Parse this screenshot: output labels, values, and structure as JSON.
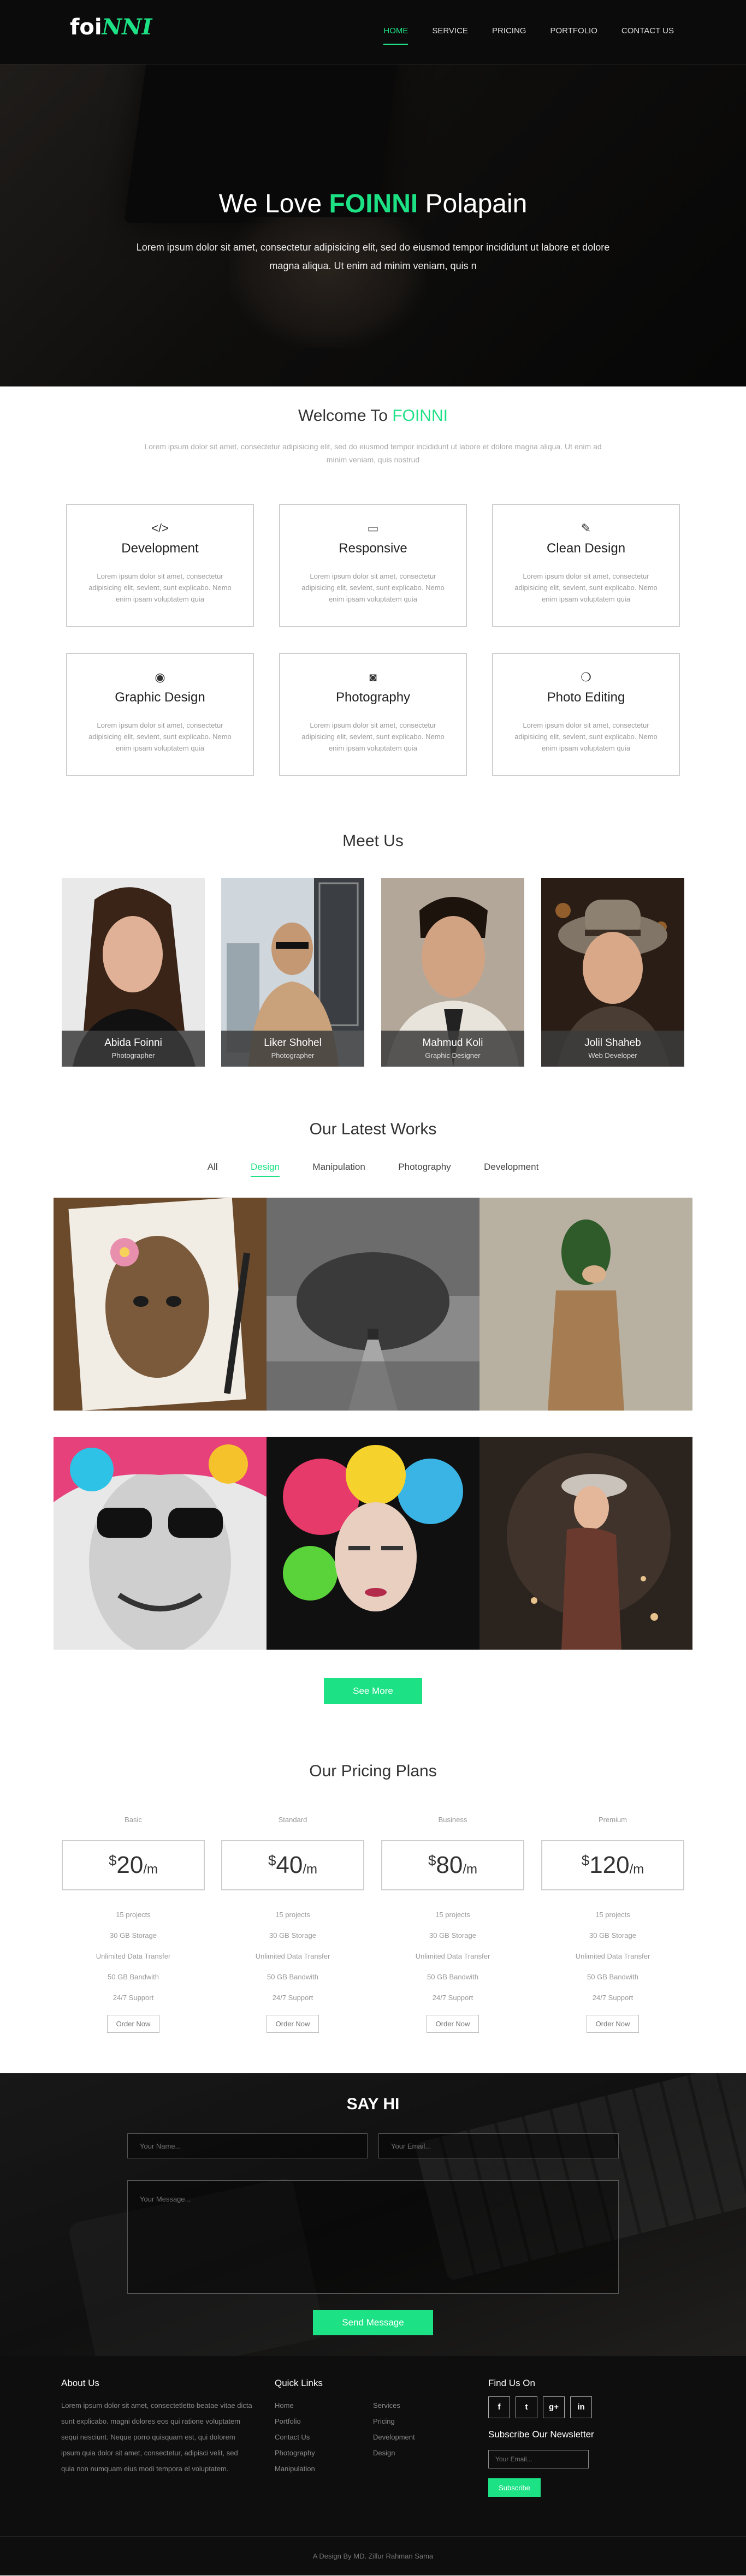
{
  "nav": {
    "logo_main": "foi",
    "logo_accent": "NNI",
    "items": [
      "HOME",
      "SERVICE",
      "PRICING",
      "PORTFOLIO",
      "CONTACT US"
    ],
    "active": "HOME"
  },
  "hero": {
    "title_pre": "We Love ",
    "title_accent": "FOINNI",
    "title_post": " Polapain",
    "text": "Lorem ipsum dolor sit amet, consectetur adipisicing elit, sed do eiusmod tempor incididunt ut labore et dolore magna aliqua. Ut enim ad minim veniam, quis n"
  },
  "welcome": {
    "title_pre": "Welcome To ",
    "title_accent": "FOINNI",
    "text": "Lorem ipsum dolor sit amet, consectetur adipisicing elit, sed do eiusmod tempor incididunt ut labore et dolore magna aliqua. Ut enim ad minim veniam, quis nostrud"
  },
  "services": [
    {
      "icon": "code-icon",
      "glyph": "</>",
      "title": "Development",
      "text": "Lorem ipsum dolor sit amet, consectetur adipisicing elit, sevlent, sunt explicabo. Nemo enim ipsam voluptatem quia"
    },
    {
      "icon": "monitor-icon",
      "glyph": "▭",
      "title": "Responsive",
      "text": "Lorem ipsum dolor sit amet, consectetur adipisicing elit, sevlent, sunt explicabo. Nemo enim ipsam voluptatem quia"
    },
    {
      "icon": "brush-icon",
      "glyph": "✎",
      "title": "Clean Design",
      "text": "Lorem ipsum dolor sit amet, consectetur adipisicing elit, sevlent, sunt explicabo. Nemo enim ipsam voluptatem quia"
    },
    {
      "icon": "eye-icon",
      "glyph": "◉",
      "title": "Graphic Design",
      "text": "Lorem ipsum dolor sit amet, consectetur adipisicing elit, sevlent, sunt explicabo. Nemo enim ipsam voluptatem quia"
    },
    {
      "icon": "camera-icon",
      "glyph": "◙",
      "title": "Photography",
      "text": "Lorem ipsum dolor sit amet, consectetur adipisicing elit, sevlent, sunt explicabo. Nemo enim ipsam voluptatem quia"
    },
    {
      "icon": "aperture-icon",
      "glyph": "❍",
      "title": "Photo Editing",
      "text": "Lorem ipsum dolor sit amet, consectetur adipisicing elit, sevlent, sunt explicabo. Nemo enim ipsam voluptatem quia"
    }
  ],
  "team": {
    "title": "Meet Us",
    "members": [
      {
        "name": "Abida Foinni",
        "role": "Photographer"
      },
      {
        "name": "Liker Shohel",
        "role": "Photographer"
      },
      {
        "name": "Mahmud Koli",
        "role": "Graphic Designer"
      },
      {
        "name": "Jolil Shaheb",
        "role": "Web Developer"
      }
    ]
  },
  "works": {
    "title": "Our Latest Works",
    "filters": [
      "All",
      "Design",
      "Manipulation",
      "Photography",
      "Development"
    ],
    "active_filter": "Design",
    "see_more": "See More"
  },
  "pricing": {
    "title": "Our Pricing Plans",
    "plans": [
      {
        "name": "Basic",
        "currency": "$",
        "price": "20",
        "per": "/m"
      },
      {
        "name": "Standard",
        "currency": "$",
        "price": "40",
        "per": "/m"
      },
      {
        "name": "Business",
        "currency": "$",
        "price": "80",
        "per": "/m"
      },
      {
        "name": "Premium",
        "currency": "$",
        "price": "120",
        "per": "/m"
      }
    ],
    "features": [
      "15 projects",
      "30 GB Storage",
      "Unlimited Data Transfer",
      "50 GB Bandwith",
      "24/7 Support"
    ],
    "order_label": "Order Now"
  },
  "contact": {
    "title": "SAY HI",
    "name_placeholder": "Your Name...",
    "email_placeholder": "Your Email...",
    "message_placeholder": "Your Message...",
    "send_label": "Send Message"
  },
  "footer": {
    "about_title": "About Us",
    "about_text": "Lorem ipsum dolor sit amet, consectetletto beatae vitae dicta sunt explicabo. magni dolores eos qui ratione voluptatem sequi nesciunt. Neque porro quisquam est, qui dolorem ipsum quia dolor sit amet, consectetur, adipisci velit, sed quia non numquam eius modi tempora el voluptatem.",
    "quick_title": "Quick Links",
    "links_col1": [
      "Home",
      "Portfolio",
      "Contact Us",
      "Photography",
      "Manipulation"
    ],
    "links_col2": [
      "Services",
      "Pricing",
      "Development",
      "Design"
    ],
    "find_title": "Find Us On",
    "social": [
      {
        "icon": "facebook-icon",
        "glyph": "f"
      },
      {
        "icon": "twitter-icon",
        "glyph": "t"
      },
      {
        "icon": "google-plus-icon",
        "glyph": "g+"
      },
      {
        "icon": "linkedin-icon",
        "glyph": "in"
      }
    ],
    "newsletter_title": "Subscribe Our Newsletter",
    "newsletter_placeholder": "Your Email...",
    "subscribe_label": "Subscribe",
    "credit": "A Design By MD. Zillur Rahman Sama"
  },
  "colors": {
    "accent": "#1de285",
    "dark": "#0e0e0e"
  }
}
